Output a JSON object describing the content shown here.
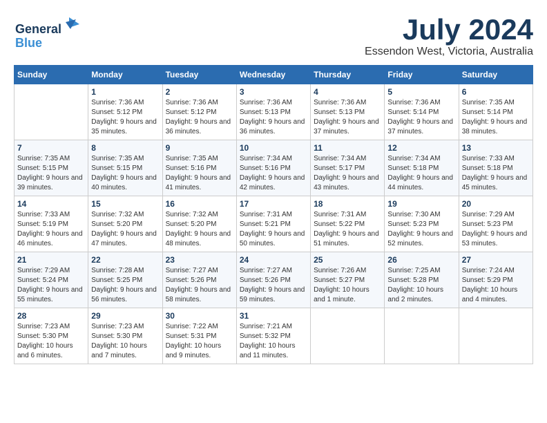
{
  "logo": {
    "line1": "General",
    "line2": "Blue"
  },
  "title": "July 2024",
  "location": "Essendon West, Victoria, Australia",
  "days_of_week": [
    "Sunday",
    "Monday",
    "Tuesday",
    "Wednesday",
    "Thursday",
    "Friday",
    "Saturday"
  ],
  "weeks": [
    [
      {
        "day": "",
        "sunrise": "",
        "sunset": "",
        "daylight": ""
      },
      {
        "day": "1",
        "sunrise": "Sunrise: 7:36 AM",
        "sunset": "Sunset: 5:12 PM",
        "daylight": "Daylight: 9 hours and 35 minutes."
      },
      {
        "day": "2",
        "sunrise": "Sunrise: 7:36 AM",
        "sunset": "Sunset: 5:12 PM",
        "daylight": "Daylight: 9 hours and 36 minutes."
      },
      {
        "day": "3",
        "sunrise": "Sunrise: 7:36 AM",
        "sunset": "Sunset: 5:13 PM",
        "daylight": "Daylight: 9 hours and 36 minutes."
      },
      {
        "day": "4",
        "sunrise": "Sunrise: 7:36 AM",
        "sunset": "Sunset: 5:13 PM",
        "daylight": "Daylight: 9 hours and 37 minutes."
      },
      {
        "day": "5",
        "sunrise": "Sunrise: 7:36 AM",
        "sunset": "Sunset: 5:14 PM",
        "daylight": "Daylight: 9 hours and 37 minutes."
      },
      {
        "day": "6",
        "sunrise": "Sunrise: 7:35 AM",
        "sunset": "Sunset: 5:14 PM",
        "daylight": "Daylight: 9 hours and 38 minutes."
      }
    ],
    [
      {
        "day": "7",
        "sunrise": "Sunrise: 7:35 AM",
        "sunset": "Sunset: 5:15 PM",
        "daylight": "Daylight: 9 hours and 39 minutes."
      },
      {
        "day": "8",
        "sunrise": "Sunrise: 7:35 AM",
        "sunset": "Sunset: 5:15 PM",
        "daylight": "Daylight: 9 hours and 40 minutes."
      },
      {
        "day": "9",
        "sunrise": "Sunrise: 7:35 AM",
        "sunset": "Sunset: 5:16 PM",
        "daylight": "Daylight: 9 hours and 41 minutes."
      },
      {
        "day": "10",
        "sunrise": "Sunrise: 7:34 AM",
        "sunset": "Sunset: 5:16 PM",
        "daylight": "Daylight: 9 hours and 42 minutes."
      },
      {
        "day": "11",
        "sunrise": "Sunrise: 7:34 AM",
        "sunset": "Sunset: 5:17 PM",
        "daylight": "Daylight: 9 hours and 43 minutes."
      },
      {
        "day": "12",
        "sunrise": "Sunrise: 7:34 AM",
        "sunset": "Sunset: 5:18 PM",
        "daylight": "Daylight: 9 hours and 44 minutes."
      },
      {
        "day": "13",
        "sunrise": "Sunrise: 7:33 AM",
        "sunset": "Sunset: 5:18 PM",
        "daylight": "Daylight: 9 hours and 45 minutes."
      }
    ],
    [
      {
        "day": "14",
        "sunrise": "Sunrise: 7:33 AM",
        "sunset": "Sunset: 5:19 PM",
        "daylight": "Daylight: 9 hours and 46 minutes."
      },
      {
        "day": "15",
        "sunrise": "Sunrise: 7:32 AM",
        "sunset": "Sunset: 5:20 PM",
        "daylight": "Daylight: 9 hours and 47 minutes."
      },
      {
        "day": "16",
        "sunrise": "Sunrise: 7:32 AM",
        "sunset": "Sunset: 5:20 PM",
        "daylight": "Daylight: 9 hours and 48 minutes."
      },
      {
        "day": "17",
        "sunrise": "Sunrise: 7:31 AM",
        "sunset": "Sunset: 5:21 PM",
        "daylight": "Daylight: 9 hours and 50 minutes."
      },
      {
        "day": "18",
        "sunrise": "Sunrise: 7:31 AM",
        "sunset": "Sunset: 5:22 PM",
        "daylight": "Daylight: 9 hours and 51 minutes."
      },
      {
        "day": "19",
        "sunrise": "Sunrise: 7:30 AM",
        "sunset": "Sunset: 5:23 PM",
        "daylight": "Daylight: 9 hours and 52 minutes."
      },
      {
        "day": "20",
        "sunrise": "Sunrise: 7:29 AM",
        "sunset": "Sunset: 5:23 PM",
        "daylight": "Daylight: 9 hours and 53 minutes."
      }
    ],
    [
      {
        "day": "21",
        "sunrise": "Sunrise: 7:29 AM",
        "sunset": "Sunset: 5:24 PM",
        "daylight": "Daylight: 9 hours and 55 minutes."
      },
      {
        "day": "22",
        "sunrise": "Sunrise: 7:28 AM",
        "sunset": "Sunset: 5:25 PM",
        "daylight": "Daylight: 9 hours and 56 minutes."
      },
      {
        "day": "23",
        "sunrise": "Sunrise: 7:27 AM",
        "sunset": "Sunset: 5:26 PM",
        "daylight": "Daylight: 9 hours and 58 minutes."
      },
      {
        "day": "24",
        "sunrise": "Sunrise: 7:27 AM",
        "sunset": "Sunset: 5:26 PM",
        "daylight": "Daylight: 9 hours and 59 minutes."
      },
      {
        "day": "25",
        "sunrise": "Sunrise: 7:26 AM",
        "sunset": "Sunset: 5:27 PM",
        "daylight": "Daylight: 10 hours and 1 minute."
      },
      {
        "day": "26",
        "sunrise": "Sunrise: 7:25 AM",
        "sunset": "Sunset: 5:28 PM",
        "daylight": "Daylight: 10 hours and 2 minutes."
      },
      {
        "day": "27",
        "sunrise": "Sunrise: 7:24 AM",
        "sunset": "Sunset: 5:29 PM",
        "daylight": "Daylight: 10 hours and 4 minutes."
      }
    ],
    [
      {
        "day": "28",
        "sunrise": "Sunrise: 7:23 AM",
        "sunset": "Sunset: 5:30 PM",
        "daylight": "Daylight: 10 hours and 6 minutes."
      },
      {
        "day": "29",
        "sunrise": "Sunrise: 7:23 AM",
        "sunset": "Sunset: 5:30 PM",
        "daylight": "Daylight: 10 hours and 7 minutes."
      },
      {
        "day": "30",
        "sunrise": "Sunrise: 7:22 AM",
        "sunset": "Sunset: 5:31 PM",
        "daylight": "Daylight: 10 hours and 9 minutes."
      },
      {
        "day": "31",
        "sunrise": "Sunrise: 7:21 AM",
        "sunset": "Sunset: 5:32 PM",
        "daylight": "Daylight: 10 hours and 11 minutes."
      },
      {
        "day": "",
        "sunrise": "",
        "sunset": "",
        "daylight": ""
      },
      {
        "day": "",
        "sunrise": "",
        "sunset": "",
        "daylight": ""
      },
      {
        "day": "",
        "sunrise": "",
        "sunset": "",
        "daylight": ""
      }
    ]
  ]
}
